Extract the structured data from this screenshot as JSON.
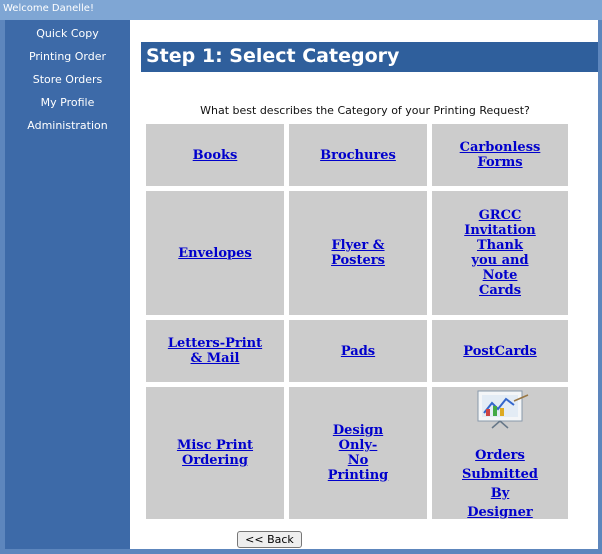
{
  "header": {
    "welcome": "Welcome Danelle!"
  },
  "sidebar": {
    "items": [
      {
        "label": "Quick Copy"
      },
      {
        "label": "Printing Order"
      },
      {
        "label": "Store Orders"
      },
      {
        "label": "My Profile"
      },
      {
        "label": "Administration"
      }
    ]
  },
  "main": {
    "title": "Step 1: Select Category",
    "question": "What best describes the Category of your Printing Request?",
    "categories": [
      {
        "label": "Books"
      },
      {
        "label": "Brochures"
      },
      {
        "label": "Carbonless\nForms"
      },
      {
        "label": "Envelopes"
      },
      {
        "label": "Flyer &\nPosters"
      },
      {
        "label": "GRCC\nInvitation\nThank\nyou and\nNote\nCards"
      },
      {
        "label": "Letters-Print\n& Mail"
      },
      {
        "label": "Pads"
      },
      {
        "label": "PostCards"
      },
      {
        "label": "Misc Print\nOrdering"
      },
      {
        "label": "Design\nOnly-\nNo\nPrinting"
      },
      {
        "label": "Orders\nSubmitted\nBy\nDesigner",
        "icon": "presentation-easel-icon"
      }
    ],
    "back_label": "<< Back"
  },
  "colors": {
    "sidebar": "#3d6aa8",
    "header_bar": "#2f5f9c",
    "topbar": "#7fa6d4",
    "cell_bg": "#cccccc",
    "link": "#0000cc"
  }
}
